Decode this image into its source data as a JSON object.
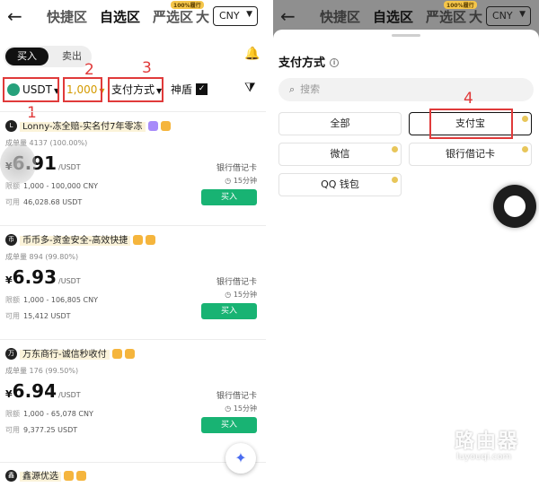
{
  "nav": {
    "tabs": [
      "快捷区",
      "自选区",
      "严选区"
    ],
    "active_tab": "自选区",
    "hot_badge": "100%履行",
    "tab_big": "大",
    "currency": "CNY"
  },
  "left": {
    "toggle": {
      "buy": "买入",
      "sell": "卖出"
    },
    "filters": {
      "asset": "USDT",
      "amount": "1,000",
      "payment": "支付方式",
      "shield": "神盾",
      "shield_checked": true
    },
    "callouts": [
      "1",
      "2",
      "3"
    ],
    "offers": [
      {
        "merchant": "Lonny-冻全赔-实名付7年零冻",
        "avatar": "L",
        "stats": "成单量 4137 (100.00%)",
        "price_symbol": "¥",
        "price": "6.91",
        "unit": "/USDT",
        "limit_label": "限额",
        "limit_value": "1,000 - 100,000 CNY",
        "avail_label": "可用",
        "avail_value": "46,028.68 USDT",
        "payment": "银行借记卡",
        "time": "15分钟",
        "buy": "买入"
      },
      {
        "merchant": "币币多-资金安全-高效快捷",
        "avatar": "币",
        "stats": "成单量 894 (99.80%)",
        "price_symbol": "¥",
        "price": "6.93",
        "unit": "/USDT",
        "limit_label": "限额",
        "limit_value": "1,000 - 106,805 CNY",
        "avail_label": "可用",
        "avail_value": "15,412 USDT",
        "payment": "银行借记卡",
        "time": "15分钟",
        "buy": "买入"
      },
      {
        "merchant": "万东商行-诚信秒收付",
        "avatar": "万",
        "stats": "成单量 176 (99.50%)",
        "price_symbol": "¥",
        "price": "6.94",
        "unit": "/USDT",
        "limit_label": "限额",
        "limit_value": "1,000 - 65,078 CNY",
        "avail_label": "可用",
        "avail_value": "9,377.25 USDT",
        "payment": "银行借记卡",
        "time": "15分钟",
        "buy": "买入"
      },
      {
        "merchant": "鑫源优选",
        "avatar": "鑫"
      }
    ]
  },
  "right": {
    "title": "支付方式",
    "search_placeholder": "搜索",
    "options": [
      "全部",
      "支付宝",
      "微信",
      "银行借记卡",
      "QQ 钱包"
    ],
    "selected": "支付宝",
    "callout": "4"
  },
  "watermark": {
    "title": "路由器",
    "sub": "luyouqi.com"
  },
  "colors": {
    "accent_green": "#18b373",
    "callout_red": "#e03a3a",
    "amount_gold": "#d49a00"
  }
}
